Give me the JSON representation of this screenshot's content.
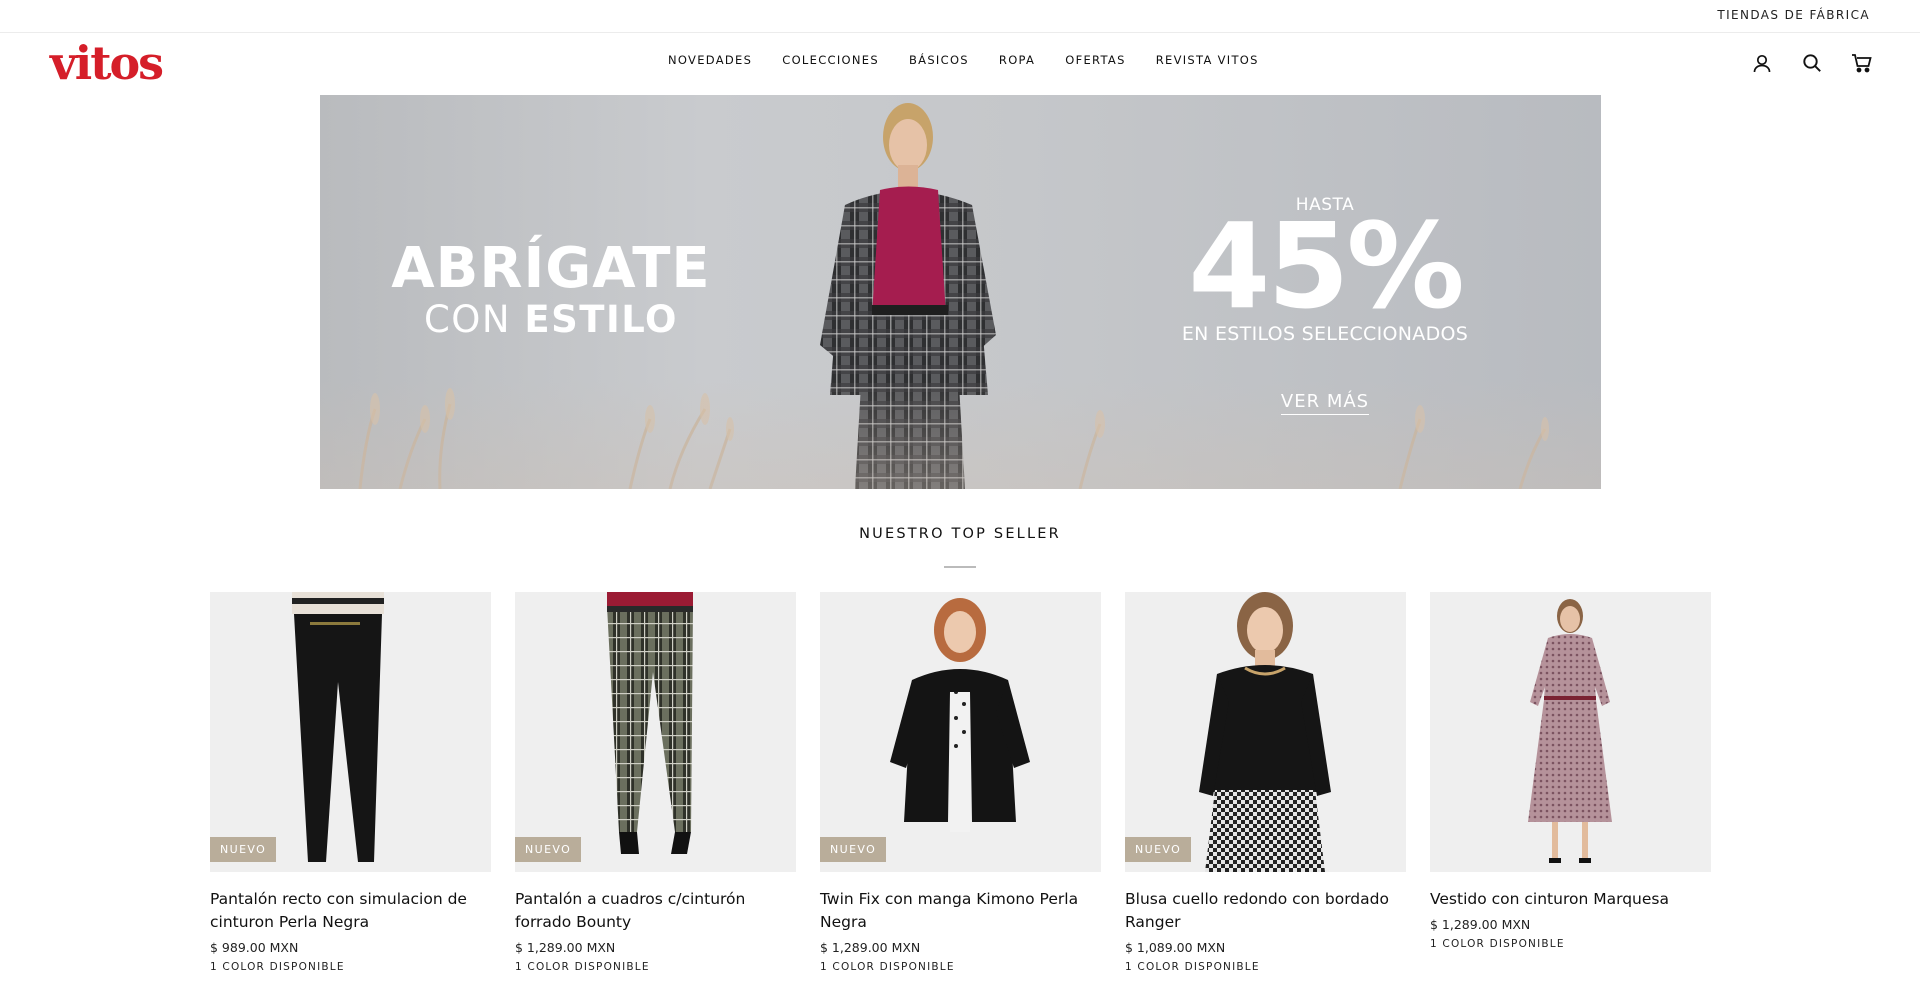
{
  "topbar": {
    "link": "TIENDAS DE FÁBRICA"
  },
  "header": {
    "logo": "vitos",
    "nav": [
      "NOVEDADES",
      "COLECCIONES",
      "BÁSICOS",
      "ROPA",
      "OFERTAS",
      "REVISTA VITOS"
    ],
    "icons": [
      "account-icon",
      "search-icon",
      "cart-icon"
    ]
  },
  "hero": {
    "title": "ABRÍGATE",
    "sub_pre": "CON",
    "sub_bold": "ESTILO",
    "hasta": "HASTA",
    "percent": "45%",
    "estilos": "EN ESTILOS SELECCIONADOS",
    "cta": "VER MÁS"
  },
  "section": {
    "title": "NUESTRO TOP SELLER"
  },
  "products": [
    {
      "name": "Pantalón recto con simulacion de cinturon Perla Negra",
      "price": "$ 989.00 MXN",
      "colors": "1 COLOR DISPONIBLE",
      "badge": "NUEVO"
    },
    {
      "name": "Pantalón a cuadros c/cinturón forrado Bounty",
      "price": "$ 1,289.00 MXN",
      "colors": "1 COLOR DISPONIBLE",
      "badge": "NUEVO"
    },
    {
      "name": "Twin Fix con manga Kimono Perla Negra",
      "price": "$ 1,289.00 MXN",
      "colors": "1 COLOR DISPONIBLE",
      "badge": "NUEVO"
    },
    {
      "name": "Blusa cuello redondo con bordado Ranger",
      "price": "$ 1,089.00 MXN",
      "colors": "1 COLOR DISPONIBLE",
      "badge": "NUEVO"
    },
    {
      "name": "Vestido con cinturon Marquesa",
      "price": "$ 1,289.00 MXN",
      "colors": "1 COLOR DISPONIBLE",
      "badge": ""
    }
  ],
  "colors": {
    "brand": "#d51e29",
    "badge": "#b9ad9a",
    "card_bg": "#efefef"
  }
}
